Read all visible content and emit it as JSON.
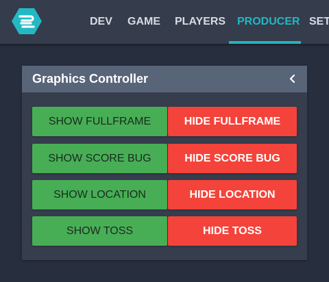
{
  "nav": {
    "items": [
      {
        "label": "DEV"
      },
      {
        "label": "GAME"
      },
      {
        "label": "PLAYERS"
      },
      {
        "label": "PRODUCER",
        "active": true
      },
      {
        "label": "SET"
      }
    ],
    "logo_icon": "hexagon-logo-icon",
    "accent_color": "#1fb4bf"
  },
  "panel": {
    "title": "Graphics Controller",
    "collapse_icon": "chevron-left-icon",
    "rows": [
      {
        "show_label": "SHOW FULLFRAME",
        "hide_label": "HIDE FULLFRAME"
      },
      {
        "show_label": "SHOW SCORE BUG",
        "hide_label": "HIDE SCORE BUG"
      },
      {
        "show_label": "SHOW LOCATION",
        "hide_label": "HIDE LOCATION"
      },
      {
        "show_label": "SHOW TOSS",
        "hide_label": "HIDE TOSS"
      }
    ]
  },
  "colors": {
    "show_button": "#47ae56",
    "hide_button": "#f4433a",
    "panel_header": "#586478",
    "background": "#272e3d"
  }
}
